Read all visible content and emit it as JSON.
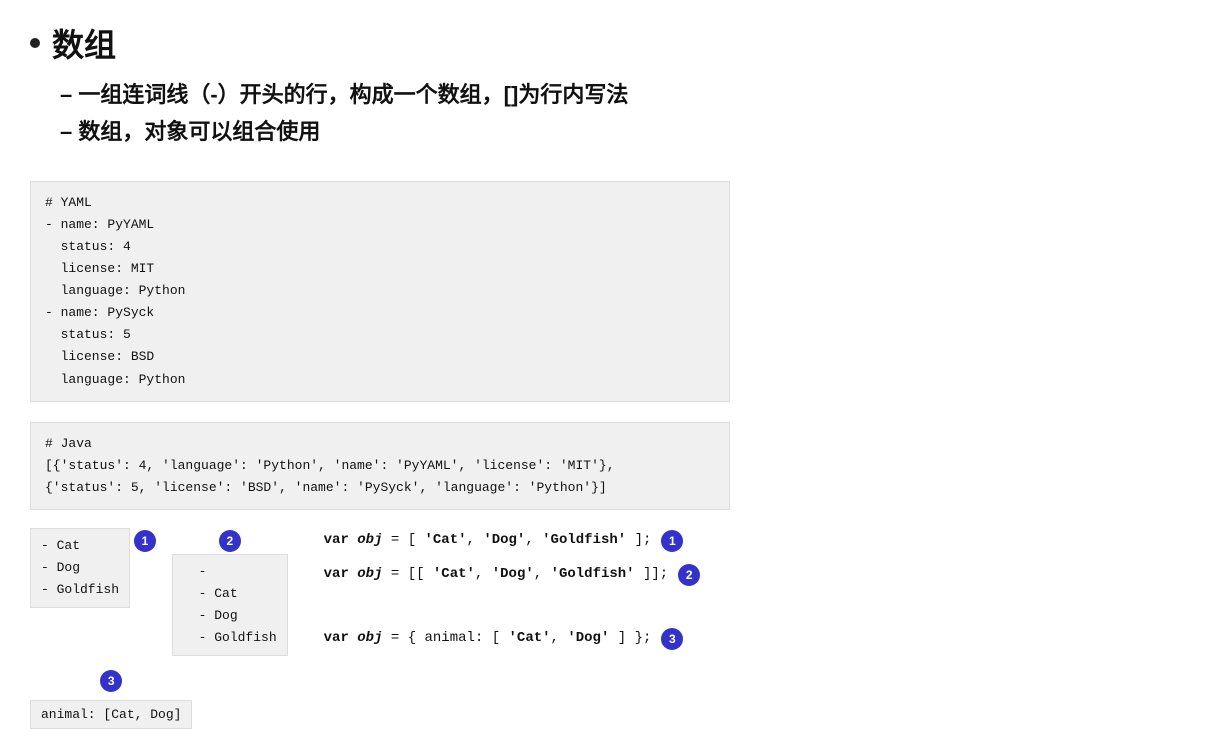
{
  "title": "数组",
  "sub_items": [
    "一组连词线（-）开头的行，构成一个数组，[]为行内写法",
    "数组，对象可以组合使用"
  ],
  "yaml_block1": "# YAML\n- name: PyYAML\n  status: 4\n  license: MIT\n  language: Python\n- name: PySyck\n  status: 5\n  license: BSD\n  language: Python",
  "java_block": "# Java\n[{'status': 4, 'language': 'Python', 'name': 'PyYAML', 'license': 'MIT'},\n{'status': 5, 'license': 'BSD', 'name': 'PySyck', 'language': 'Python'}]",
  "panel1": {
    "content": "- Cat\n- Dog\n- Goldfish",
    "badge": "1"
  },
  "panel2": {
    "content": "  -\n  - Cat\n  - Dog\n  - Goldfish",
    "badge": "2"
  },
  "panel3": {
    "content": "animal: [Cat, Dog]",
    "badge": "3"
  },
  "right1": {
    "code": "var obj = [ 'Cat', 'Dog', 'Goldfish' ];",
    "badge": "1"
  },
  "right2": {
    "code": "var obj = [[ 'Cat', 'Dog', 'Goldfish' ]];",
    "badge": "2"
  },
  "right3": {
    "code": "var obj = { animal: [ 'Cat', 'Dog' ] };",
    "badge": "3"
  }
}
